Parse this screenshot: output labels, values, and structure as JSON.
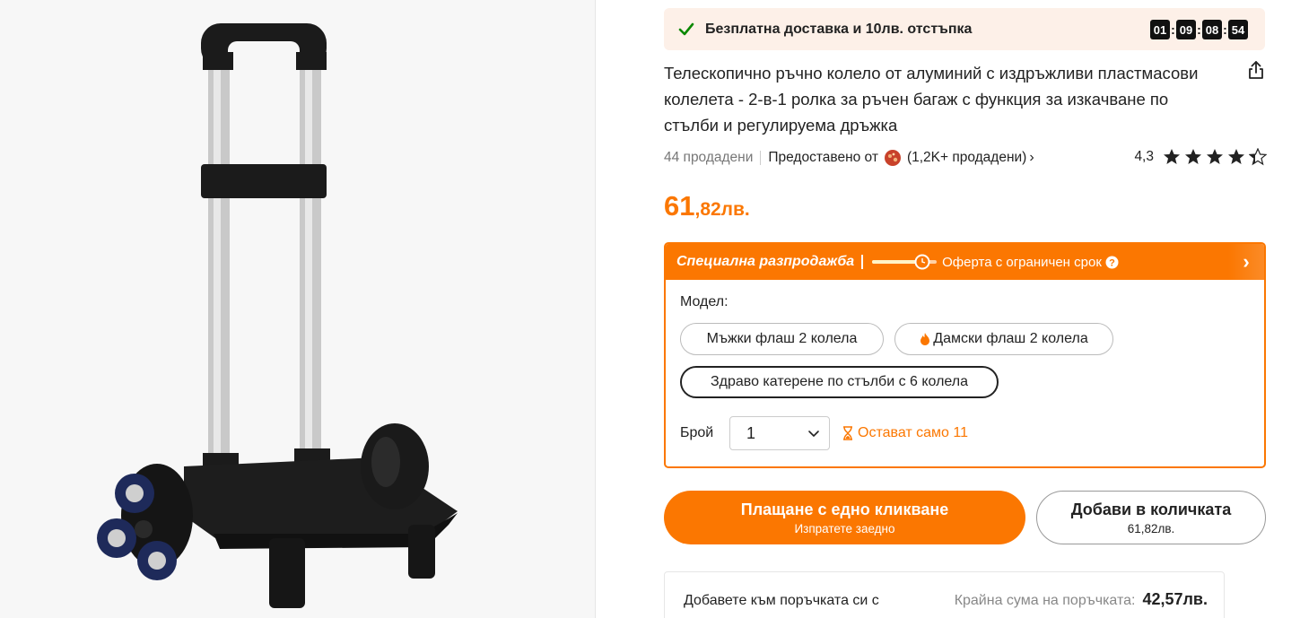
{
  "banner": {
    "text": "Безплатна доставка и 10лв. отстъпка",
    "timer": [
      "01",
      "09",
      "08",
      "54"
    ],
    "check_color": "#0a8800"
  },
  "product": {
    "title": "Телескопично ръчно колело от алуминий с издръжливи пластмасови колелета - 2-в-1 ролка за ръчен багаж с функция за изкачване по стълби и регулируема дръжка",
    "sold": "44 продадени",
    "provided_by": "Предоставено от",
    "store_sold": "(1,2K+ продадени)",
    "rating_value": "4,3",
    "rating_stars": 4.3,
    "price_main": "61",
    "price_fraction": ",82лв."
  },
  "sale": {
    "title": "Специална разпродажба",
    "subtitle": "Оферта с ограничен срок",
    "model_label": "Модел:",
    "options": [
      {
        "label": "Мъжки флаш 2 колела",
        "selected": false,
        "hot": false
      },
      {
        "label": "Дамски флаш 2 колела",
        "selected": false,
        "hot": true
      },
      {
        "label": "Здраво катерене по стълби с 6 колела",
        "selected": true,
        "hot": false
      }
    ],
    "qty_label": "Брой",
    "qty_value": "1",
    "stock_text": "Остават само 11"
  },
  "actions": {
    "buy_label": "Плащане с едно кликване",
    "buy_sub": "Изпратете заедно",
    "cart_label": "Добави в количката",
    "cart_sub": "61,82лв."
  },
  "order": {
    "add_text": "Добавете към поръчката си с",
    "total_label": "Крайна сума на поръчката:",
    "total_value": "42,57лв."
  },
  "colors": {
    "accent": "#fb7701",
    "banner_bg": "#fdf0e8"
  }
}
